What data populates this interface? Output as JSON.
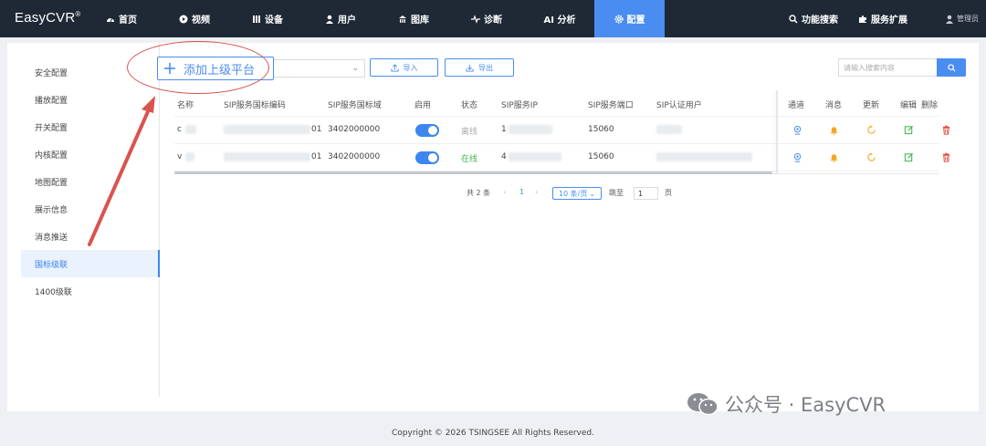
{
  "app": {
    "logo": "EasyCVR",
    "logo_mark": "®"
  },
  "nav": [
    {
      "label": "首页",
      "icon": "dashboard-icon"
    },
    {
      "label": "视频",
      "icon": "play-icon"
    },
    {
      "label": "设备",
      "icon": "device-icon"
    },
    {
      "label": "用户",
      "icon": "user-icon"
    },
    {
      "label": "图库",
      "icon": "gallery-icon"
    },
    {
      "label": "诊断",
      "icon": "pulse-icon"
    },
    {
      "label": "AI 分析",
      "icon": ""
    },
    {
      "label": "配置",
      "icon": "gear-icon",
      "active": true
    }
  ],
  "tools": {
    "search": "功能搜索",
    "extend": "服务扩展",
    "user": "管理员"
  },
  "sidebar": [
    {
      "label": "安全配置"
    },
    {
      "label": "播放配置"
    },
    {
      "label": "开关配置"
    },
    {
      "label": "内核配置"
    },
    {
      "label": "地图配置"
    },
    {
      "label": "展示信息"
    },
    {
      "label": "消息推送"
    },
    {
      "label": "国标级联",
      "active": true
    },
    {
      "label": "1400级联"
    }
  ],
  "toolbar": {
    "add_label": "添加上级平台",
    "import_label": "导入",
    "export_label": "导出",
    "search_placeholder": "请输入搜索内容"
  },
  "table": {
    "columns": [
      "名称",
      "SIP服务国标编码",
      "SIP服务国标域",
      "启用",
      "状态",
      "SIP服务IP",
      "SIP服务端口",
      "SIP认证用户",
      "通道",
      "消息",
      "更新",
      "编辑",
      "删除"
    ],
    "rows": [
      {
        "name": "c",
        "code_suffix": "01",
        "domain": "3402000000",
        "enabled": true,
        "status": "离线",
        "ip_prefix": "1",
        "port": "15060"
      },
      {
        "name": "v",
        "code_suffix": "01",
        "domain": "3402000000",
        "enabled": true,
        "status": "在线",
        "ip_prefix": "4",
        "port": "15060"
      }
    ]
  },
  "pager": {
    "total": "共 2 条",
    "page": "1",
    "size": "10 条/页",
    "jump_label": "跳至",
    "jump_value": "1",
    "page_unit": "页"
  },
  "colors": {
    "accent": "#4a8df0",
    "online": "#3bb54a",
    "offline": "#aaaaaa",
    "warn": "#f5a623",
    "danger": "#e04a3f",
    "annotation": "#d9534f"
  },
  "watermark": {
    "text": "公众号 · EasyCVR"
  },
  "footer": {
    "copyright": "Copyright © 2026 TSINGSEE All Rights Reserved."
  }
}
